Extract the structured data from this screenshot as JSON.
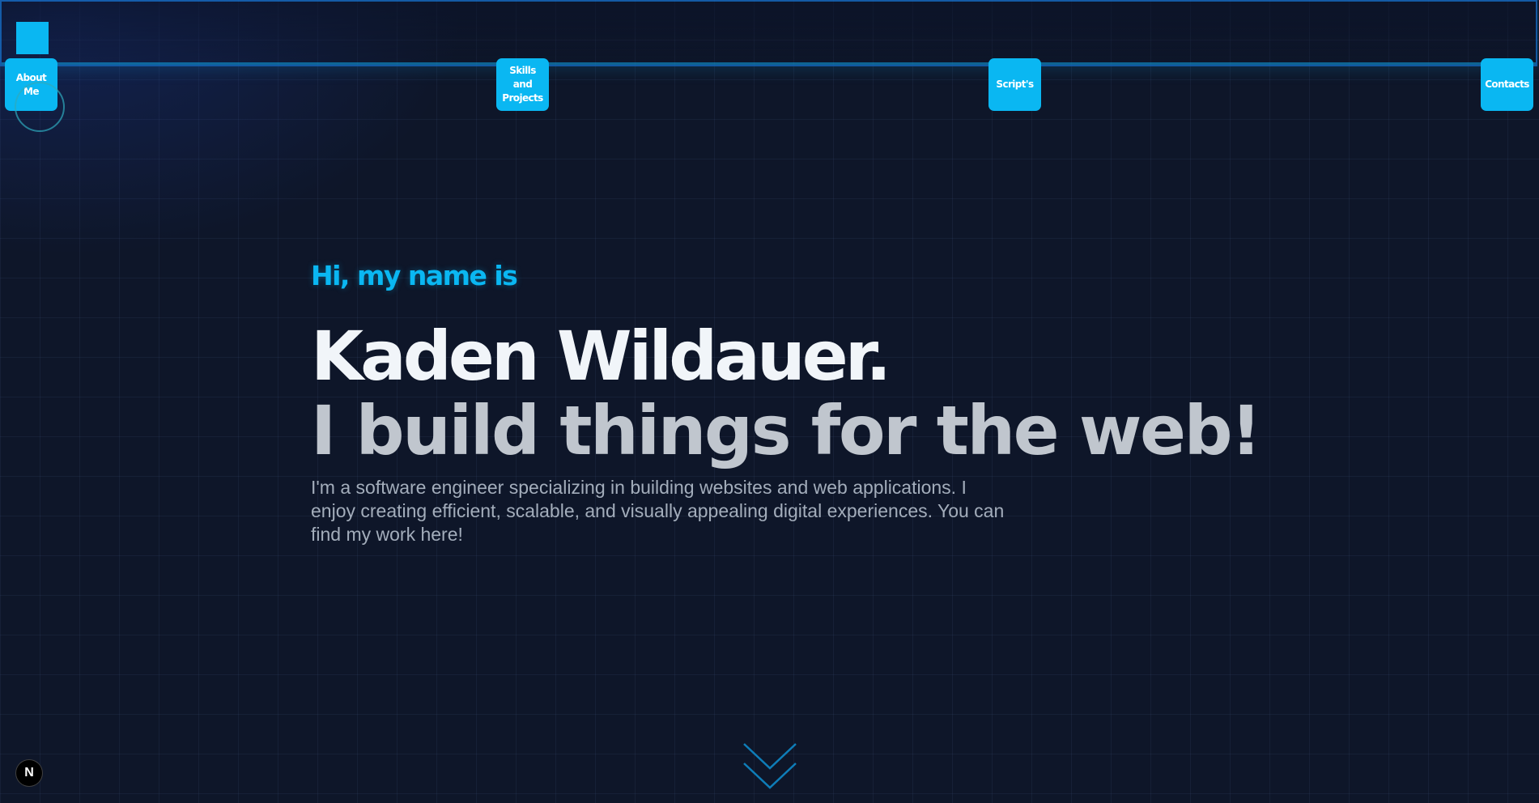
{
  "nav": {
    "items": [
      {
        "label": "About Me"
      },
      {
        "label": "Skills and Projects"
      },
      {
        "label": "Script's"
      },
      {
        "label": "Contacts"
      }
    ]
  },
  "hero": {
    "greeting": "Hi, my name is",
    "name": "Kaden Wildauer.",
    "tagline": "I build things for the web!",
    "intro": "I'm a software engineer specializing in building websites and web applications. I enjoy creating efficient, scalable, and visually appealing digital experiences. You can find my work here!"
  },
  "badge": {
    "label": "N"
  },
  "icons": {
    "scroll": "chevron-double-down-icon",
    "logo": "logo-square-icon"
  },
  "colors": {
    "accent": "#0ab7f2",
    "background": "#0e1629",
    "heading": "#f1f5f9",
    "tagline": "#c0c6ce",
    "body_text": "#a3adbb"
  }
}
